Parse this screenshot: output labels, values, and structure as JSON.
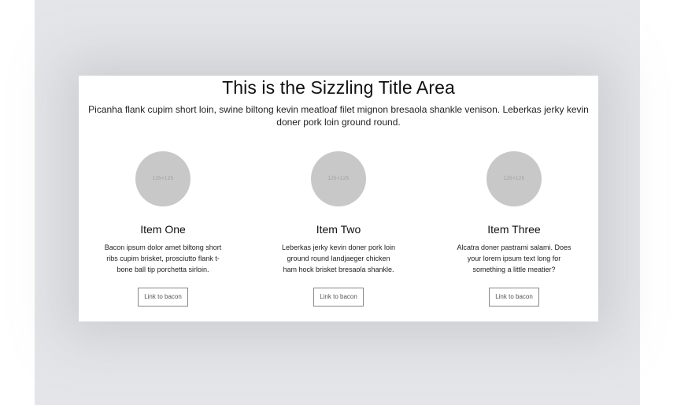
{
  "header": {
    "title": "This is the Sizzling Title Area",
    "subtitle": "Picanha flank cupim short loin, swine biltong kevin meatloaf filet mignon bresaola shankle venison. Leberkas jerky kevin doner pork loin ground round."
  },
  "items": [
    {
      "image_label": "125×125",
      "title": "Item One",
      "description": "Bacon ipsum dolor amet biltong short ribs cupim brisket, prosciutto flank t-bone ball tip porchetta sirloin.",
      "link_label": "Link to bacon"
    },
    {
      "image_label": "125×125",
      "title": "Item Two",
      "description": "Leberkas jerky kevin doner pork loin ground round landjaeger chicken ham hock brisket bresaola shankle.",
      "link_label": "Link to bacon"
    },
    {
      "image_label": "125×125",
      "title": "Item Three",
      "description": "Alcatra doner pastrami salami. Does your lorem ipsum text long for something a little meatier?",
      "link_label": "Link to bacon"
    }
  ]
}
